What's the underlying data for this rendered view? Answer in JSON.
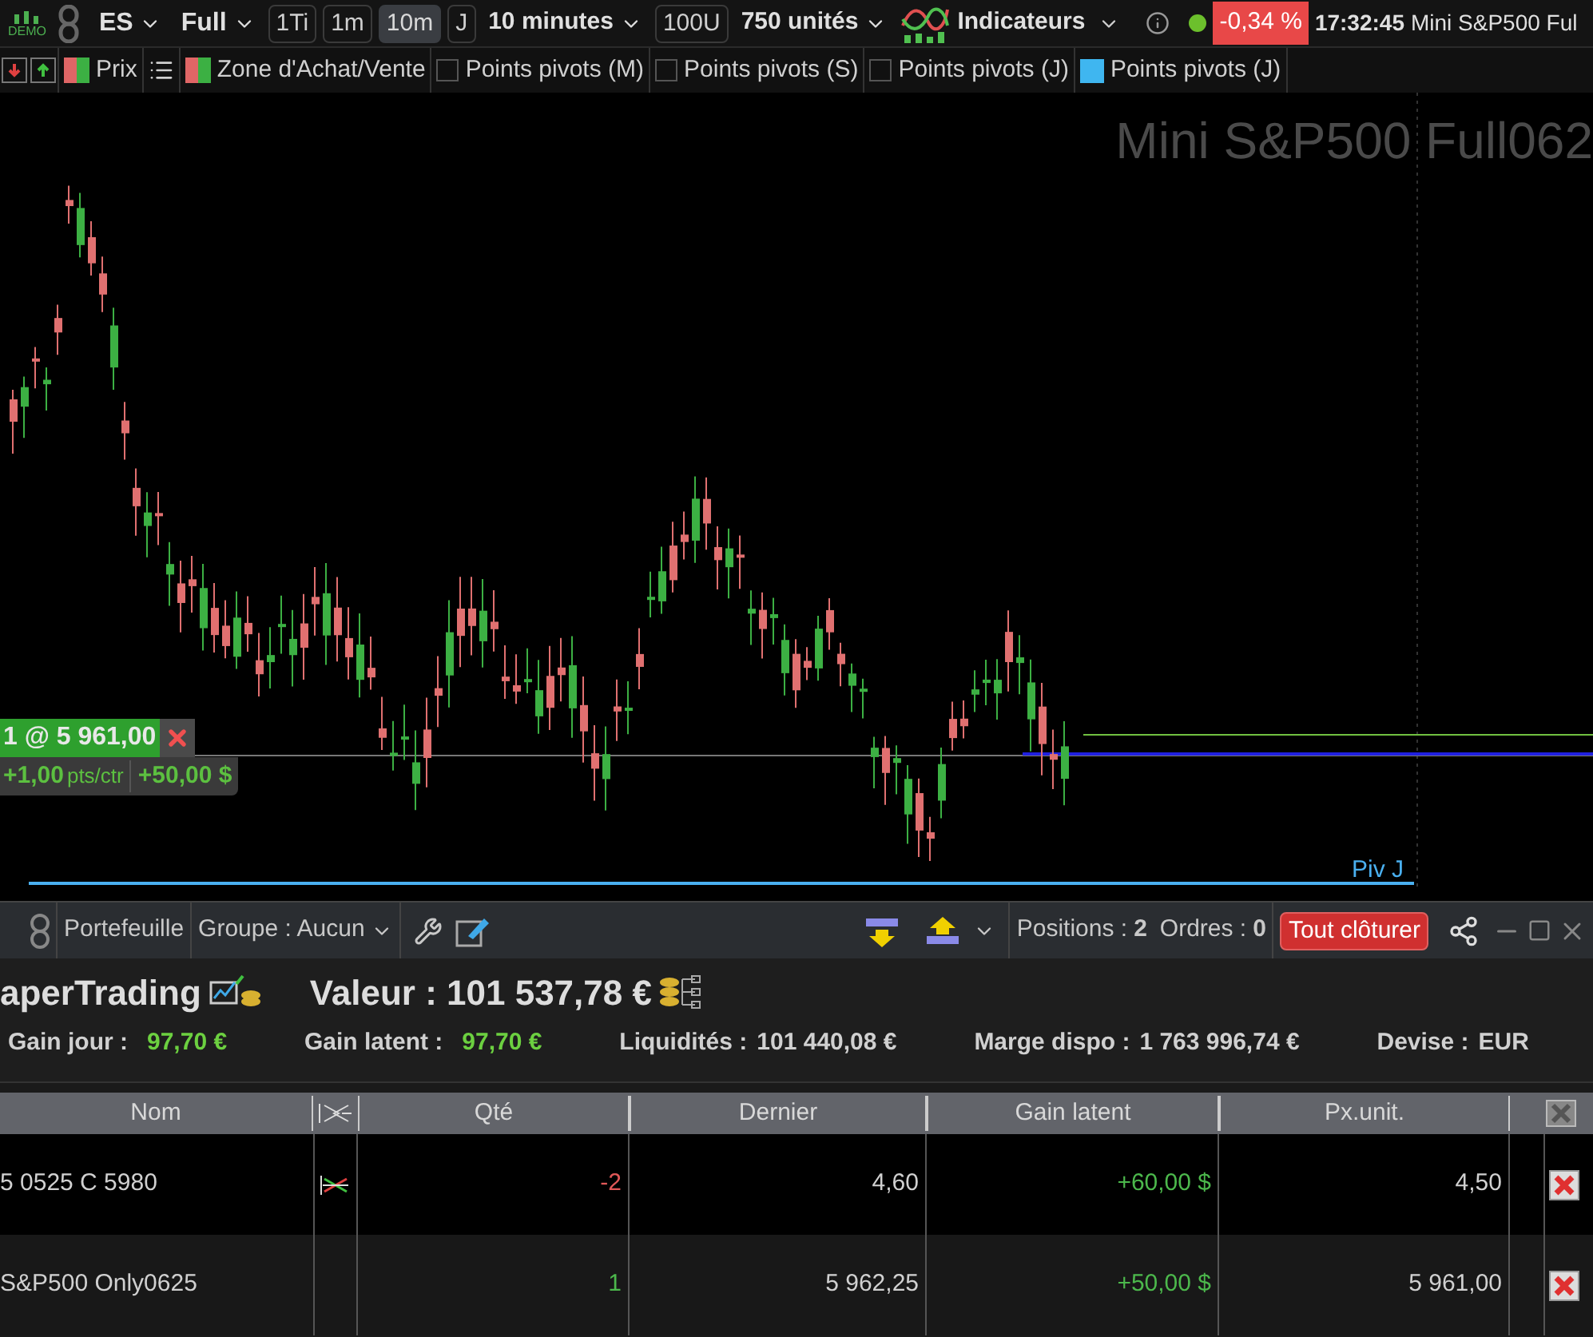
{
  "toolbar": {
    "logo": "DEMO",
    "symbol": "ES",
    "mode": "Full",
    "timeframes": [
      {
        "label": "1Ti",
        "selected": false
      },
      {
        "label": "1m",
        "selected": false
      },
      {
        "label": "10m",
        "selected": true
      },
      {
        "label": "J",
        "selected": false
      }
    ],
    "period": "10 minutes",
    "units_button": "100U",
    "units": "750 unités",
    "indicators": "Indicateurs",
    "connected": true,
    "change": "-0,34 %",
    "time": "17:32:45",
    "instrument": "Mini S&P500 Ful"
  },
  "legend": [
    {
      "kind": "price",
      "label": "Prix",
      "swatches": [
        {
          "color": "#e06666"
        },
        {
          "color": "#3cb043"
        }
      ]
    },
    {
      "kind": "zone",
      "label": "Zone d'Achat/Vente",
      "swatches": [
        {
          "color": "#e06666"
        },
        {
          "color": "#3cb043"
        }
      ]
    },
    {
      "kind": "checkbox",
      "label": "Points pivots (M)",
      "checked": false
    },
    {
      "kind": "checkbox",
      "label": "Points pivots (S)",
      "checked": false
    },
    {
      "kind": "checkbox",
      "label": "Points pivots (J)",
      "checked": false
    },
    {
      "kind": "swatch",
      "label": "Points pivots (J)",
      "color": "#3fb6f0"
    }
  ],
  "chart": {
    "title": "Mini S&P500 Full062",
    "position": "1 @ 5 961,00",
    "points": "+1,00",
    "points_unit": "pts/ctr",
    "pnl": "+50,00 $",
    "pivot_label": "Piv J"
  },
  "panel": {
    "tab": "Portefeuille",
    "group": "Groupe : Aucun",
    "positions_label": "Positions :",
    "positions": "2",
    "orders_label": "Ordres :",
    "orders": "0",
    "close_all": "Tout clôturer"
  },
  "account": {
    "name": "aperTrading",
    "value": "Valeur : 101 537,78 €",
    "stats": [
      {
        "label": "Gain jour :",
        "value": "97,70 €",
        "highlight": true
      },
      {
        "label": "Gain latent :",
        "value": "97,70 €",
        "highlight": true
      },
      {
        "label": "Liquidités :",
        "value": "101 440,08 €",
        "highlight": false
      },
      {
        "label": "Marge dispo :",
        "value": "1 763 996,74 €",
        "highlight": false
      },
      {
        "label": "Devise :",
        "value": "EUR",
        "highlight": false
      }
    ]
  },
  "table": {
    "columns": [
      "Nom",
      "Qté",
      "Dernier",
      "Gain latent",
      "Px.unit."
    ],
    "rows": [
      {
        "name": "5 0525 C 5980",
        "kind": "short",
        "qty": "-2",
        "last": "4,60",
        "gain": "+60,00 $",
        "gain_positive": true,
        "price": "4,50",
        "selected": true
      },
      {
        "name": "S&P500 Only0625",
        "kind": "long",
        "qty": "1",
        "last": "5 962,25",
        "gain": "+50,00 $",
        "gain_positive": true,
        "price": "5 961,00",
        "selected": false
      }
    ]
  }
}
